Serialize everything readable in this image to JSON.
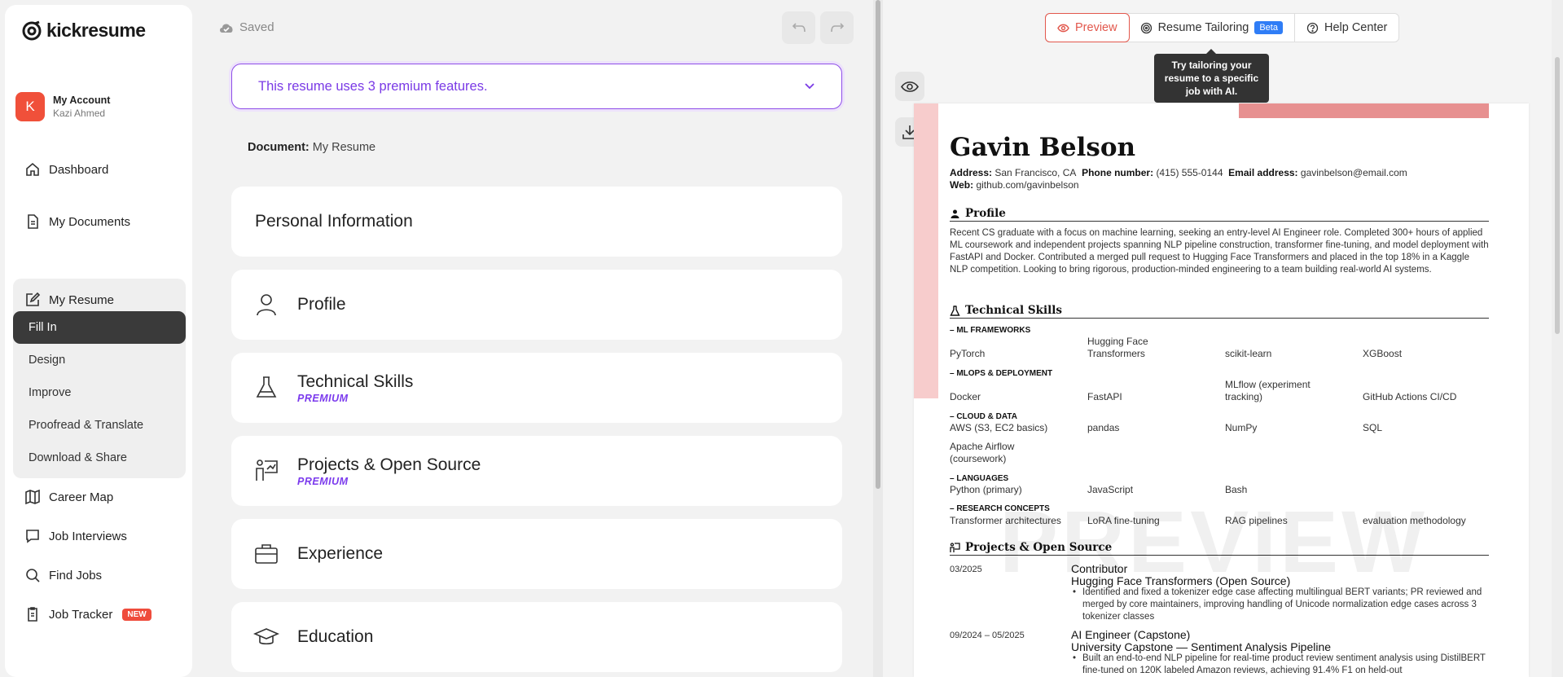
{
  "app": {
    "brand": "kickresume"
  },
  "account": {
    "initial": "K",
    "label": "My Account",
    "user": "Kazi Ahmed"
  },
  "nav": {
    "dashboard": "Dashboard",
    "documents": "My Documents",
    "resume": "My Resume",
    "sub": [
      "Fill In",
      "Design",
      "Improve",
      "Proofread & Translate",
      "Download & Share"
    ],
    "career_map": "Career Map",
    "interviews": "Job Interviews",
    "find_jobs": "Find Jobs",
    "tracker": "Job Tracker",
    "tracker_badge": "NEW"
  },
  "editor": {
    "saved": "Saved",
    "premium_banner": "This resume uses 3 premium features.",
    "doc_label": "Document:",
    "doc_name": "My Resume",
    "sections": [
      {
        "title": "Personal Information"
      },
      {
        "title": "Profile"
      },
      {
        "title": "Technical Skills",
        "tag": "PREMIUM"
      },
      {
        "title": "Projects & Open Source",
        "tag": "PREMIUM"
      },
      {
        "title": "Experience"
      },
      {
        "title": "Education"
      }
    ]
  },
  "preview": {
    "tabs": {
      "preview": "Preview",
      "tailoring": "Resume Tailoring",
      "beta": "Beta",
      "help": "Help Center"
    },
    "tooltip": "Try tailoring your resume to a specific job with AI.",
    "watermark": "PREVIEW"
  },
  "resume": {
    "name": "Gavin Belson",
    "address_label": "Address:",
    "address": "San Francisco, CA",
    "phone_label": "Phone number:",
    "phone": "(415) 555-0144",
    "email_label": "Email address:",
    "email": "gavinbelson@email.com",
    "web_label": "Web:",
    "web": "github.com/gavinbelson",
    "profile_heading": "Profile",
    "profile_text": "Recent CS graduate with a focus on machine learning, seeking an entry-level AI Engineer role. Completed 300+ hours of applied ML coursework and independent projects spanning NLP pipeline construction, transformer fine-tuning, and model deployment with FastAPI and Docker. Contributed a merged pull request to Hugging Face Transformers and placed in the top 18% in a Kaggle NLP competition. Looking to bring rigorous, production-minded engineering to a team building real-world AI systems.",
    "skills_heading": "Technical Skills",
    "skill_cats": [
      "– ML FRAMEWORKS",
      "– MLOPS & DEPLOYMENT",
      "– CLOUD & DATA",
      "– LANGUAGES",
      "– RESEARCH CONCEPTS"
    ],
    "skills": {
      "ml": [
        "PyTorch",
        "Hugging Face Transformers",
        "scikit-learn",
        "XGBoost"
      ],
      "mlops": [
        "Docker",
        "FastAPI",
        "MLflow (experiment tracking)",
        "GitHub Actions CI/CD"
      ],
      "cloud": [
        "AWS (S3, EC2 basics)",
        "pandas",
        "NumPy",
        "SQL",
        "Apache Airflow (coursework)"
      ],
      "lang": [
        "Python (primary)",
        "JavaScript",
        "Bash"
      ],
      "research": [
        "Transformer architectures",
        "LoRA fine-tuning",
        "RAG pipelines",
        "evaluation methodology"
      ]
    },
    "projects_heading": "Projects & Open Source",
    "projects": [
      {
        "date": "03/2025",
        "role": "Contributor",
        "org": "Hugging Face Transformers (Open Source)",
        "bullet": "Identified and fixed a tokenizer edge case affecting multilingual BERT variants; PR reviewed and merged by core maintainers, improving handling of Unicode normalization edge cases across 3 tokenizer classes"
      },
      {
        "date": "09/2024 – 05/2025",
        "role": "AI Engineer (Capstone)",
        "org": "University Capstone — Sentiment Analysis Pipeline",
        "bullet": "Built an end-to-end NLP pipeline for real-time product review sentiment analysis using DistilBERT fine-tuned on 120K labeled Amazon reviews, achieving 91.4% F1 on held-out"
      }
    ]
  },
  "colors": {
    "accent": "#7a3ae6",
    "brand_red": "#e2574c",
    "avatar": "#f0503a",
    "beta": "#2f7df6"
  }
}
